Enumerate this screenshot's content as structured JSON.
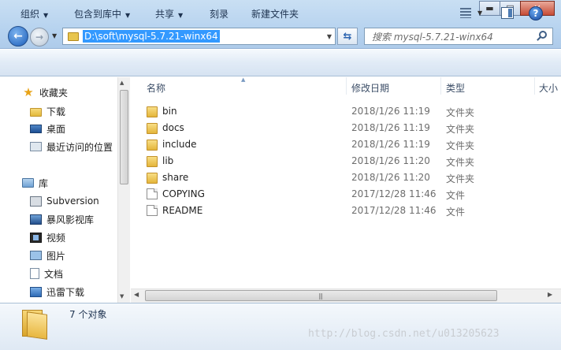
{
  "window": {
    "title": "",
    "controls": {
      "minimize": "▬",
      "maximize": "□",
      "close": "✕"
    }
  },
  "address_bar": {
    "path": "D:\\soft\\mysql-5.7.21-winx64",
    "refresh_icon": "refresh-icon"
  },
  "search": {
    "placeholder": "搜索 mysql-5.7.21-winx64"
  },
  "toolbar": {
    "organize": "组织",
    "include_in_library": "包含到库中",
    "share": "共享",
    "burn": "刻录",
    "new_folder": "新建文件夹"
  },
  "sidebar": {
    "favorites": {
      "label": "收藏夹",
      "items": [
        {
          "label": "下载",
          "icon": "folder-icon"
        },
        {
          "label": "桌面",
          "icon": "desktop-icon"
        },
        {
          "label": "最近访问的位置",
          "icon": "recent-places-icon"
        }
      ]
    },
    "libraries": {
      "label": "库",
      "items": [
        {
          "label": "Subversion",
          "icon": "subversion-icon"
        },
        {
          "label": "暴风影视库",
          "icon": "video-library-icon"
        },
        {
          "label": "视频",
          "icon": "videos-icon"
        },
        {
          "label": "图片",
          "icon": "pictures-icon"
        },
        {
          "label": "文档",
          "icon": "documents-icon"
        },
        {
          "label": "迅雷下载",
          "icon": "thunder-download-icon"
        }
      ]
    }
  },
  "columns": {
    "name": "名称",
    "date": "修改日期",
    "type": "类型",
    "size": "大小"
  },
  "files": [
    {
      "name": "bin",
      "date": "2018/1/26 11:19",
      "type": "文件夹",
      "kind": "folder"
    },
    {
      "name": "docs",
      "date": "2018/1/26 11:19",
      "type": "文件夹",
      "kind": "folder"
    },
    {
      "name": "include",
      "date": "2018/1/26 11:19",
      "type": "文件夹",
      "kind": "folder"
    },
    {
      "name": "lib",
      "date": "2018/1/26 11:20",
      "type": "文件夹",
      "kind": "folder"
    },
    {
      "name": "share",
      "date": "2018/1/26 11:20",
      "type": "文件夹",
      "kind": "folder"
    },
    {
      "name": "COPYING",
      "date": "2017/12/28 11:46",
      "type": "文件",
      "kind": "file"
    },
    {
      "name": "README",
      "date": "2017/12/28 11:46",
      "type": "文件",
      "kind": "file"
    }
  ],
  "status": {
    "count": "7 个对象"
  },
  "watermark": "http://blog.csdn.net/u013205623"
}
